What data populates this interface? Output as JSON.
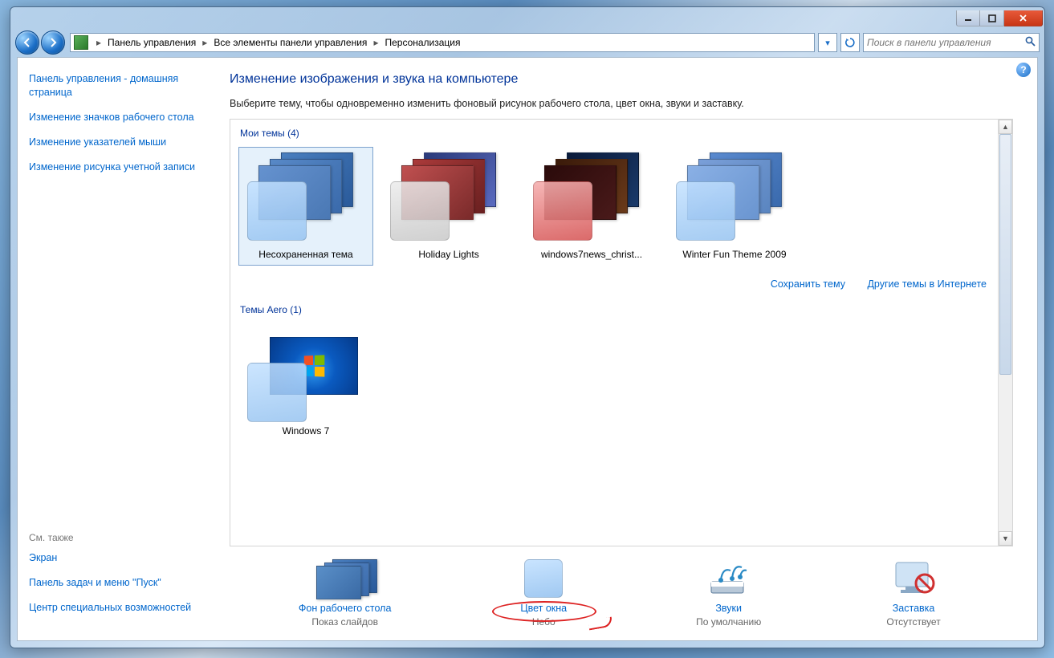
{
  "breadcrumb": {
    "items": [
      "Панель управления",
      "Все элементы панели управления",
      "Персонализация"
    ]
  },
  "search": {
    "placeholder": "Поиск в панели управления"
  },
  "sidebar": {
    "items": [
      "Панель управления - домашняя страница",
      "Изменение значков рабочего стола",
      "Изменение указателей мыши",
      "Изменение рисунка учетной записи"
    ],
    "see_also_h": "См. также",
    "see_also": [
      "Экран",
      "Панель задач и меню \"Пуск\"",
      "Центр специальных возможностей"
    ]
  },
  "main": {
    "title": "Изменение изображения и звука на компьютере",
    "desc": "Выберите тему, чтобы одновременно изменить фоновый рисунок рабочего стола, цвет окна, звуки и заставку."
  },
  "sections": {
    "my": {
      "header": "Мои темы (4)",
      "themes": [
        {
          "label": "Несохраненная тема",
          "chip": "chip-blue",
          "variant": ""
        },
        {
          "label": "Holiday Lights",
          "chip": "chip-gray",
          "variant": "v-holiday"
        },
        {
          "label": "windows7news_christ...",
          "chip": "chip-red",
          "variant": "v-christ"
        },
        {
          "label": "Winter Fun Theme 2009",
          "chip": "chip-blue",
          "variant": "v-winter"
        }
      ]
    },
    "aero": {
      "header": "Темы Aero (1)",
      "themes": [
        {
          "label": "Windows 7",
          "chip": "chip-blue",
          "variant": "v-win7"
        }
      ]
    },
    "links": {
      "save": "Сохранить тему",
      "online": "Другие темы в Интернете"
    }
  },
  "bottom": {
    "items": [
      {
        "link": "Фон рабочего стола",
        "sub": "Показ слайдов",
        "kind": "bg"
      },
      {
        "link": "Цвет окна",
        "sub": "Небо",
        "kind": "color",
        "circled": true
      },
      {
        "link": "Звуки",
        "sub": "По умолчанию",
        "kind": "sound"
      },
      {
        "link": "Заставка",
        "sub": "Отсутствует",
        "kind": "saver"
      }
    ]
  }
}
